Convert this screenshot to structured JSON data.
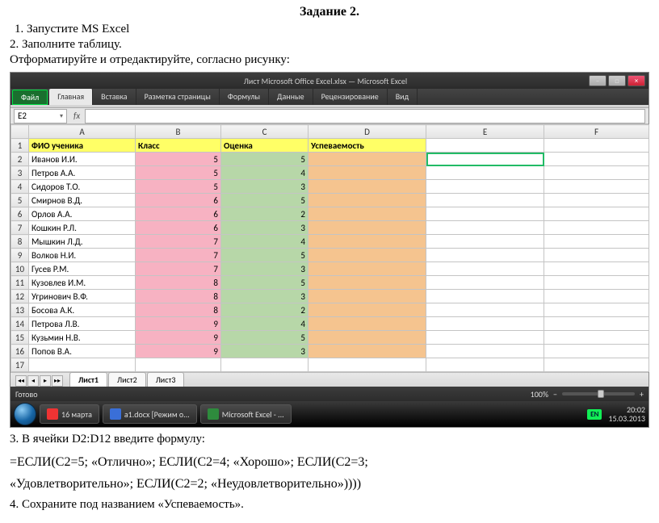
{
  "doc": {
    "title": "Задание 2.",
    "step1": "1. Запустите MS Excel",
    "step2": "2. Заполните таблицу.",
    "step2b": "Отформатируйте и отредактируйте, согласно рисунку:",
    "step3": "3. В ячейки D2:D12 введите формулу:",
    "formula_l1": "=ЕСЛИ(C2=5;  «Отлично»;  ЕСЛИ(C2=4;  «Хорошо»;  ЕСЛИ(C2=3;",
    "formula_l2": "«Удовлетворительно»; ЕСЛИ(C2=2; «Неудовлетворительно»))))",
    "step4": "4. Сохраните  под названием «Успеваемость»."
  },
  "excel": {
    "window_title": "Лист Microsoft Office Excel.xlsx  —  Microsoft Excel",
    "tabs": {
      "file": "Файл",
      "home": "Главная",
      "insert": "Вставка",
      "layout": "Разметка страницы",
      "formulas": "Формулы",
      "data": "Данные",
      "review": "Рецензирование",
      "view": "Вид"
    },
    "namebox": "E2",
    "fx": "fx",
    "columns": [
      "A",
      "B",
      "C",
      "D",
      "E",
      "F"
    ],
    "headers": {
      "A": "ФИО ученика",
      "B": "Класс",
      "C": "Оценка",
      "D": "Успеваемость"
    },
    "rows": [
      {
        "n": "2",
        "a": "Иванов И.И.",
        "b": "5",
        "c": "5"
      },
      {
        "n": "3",
        "a": "Петров А.А.",
        "b": "5",
        "c": "4"
      },
      {
        "n": "4",
        "a": "Сидоров Т.О.",
        "b": "5",
        "c": "3"
      },
      {
        "n": "5",
        "a": "Смирнов В.Д.",
        "b": "6",
        "c": "5"
      },
      {
        "n": "6",
        "a": "Орлов А.А.",
        "b": "6",
        "c": "2"
      },
      {
        "n": "7",
        "a": "Кошкин Р.Л.",
        "b": "6",
        "c": "3"
      },
      {
        "n": "8",
        "a": "Мышкин Л.Д.",
        "b": "7",
        "c": "4"
      },
      {
        "n": "9",
        "a": "Волков Н.И.",
        "b": "7",
        "c": "5"
      },
      {
        "n": "10",
        "a": "Гусев Р.М.",
        "b": "7",
        "c": "3"
      },
      {
        "n": "11",
        "a": "Кузовлев И.М.",
        "b": "8",
        "c": "5"
      },
      {
        "n": "12",
        "a": "Угринович В.Ф.",
        "b": "8",
        "c": "3"
      },
      {
        "n": "13",
        "a": "Босова А.К.",
        "b": "8",
        "c": "2"
      },
      {
        "n": "14",
        "a": "Петрова Л.В.",
        "b": "9",
        "c": "4"
      },
      {
        "n": "15",
        "a": "Кузьмин Н.В.",
        "b": "9",
        "c": "5"
      },
      {
        "n": "16",
        "a": "Попов В.А.",
        "b": "9",
        "c": "3"
      }
    ],
    "extra_row": "17",
    "sheets": {
      "s1": "Лист1",
      "s2": "Лист2",
      "s3": "Лист3"
    },
    "status": "Готово",
    "zoom": "100%"
  },
  "taskbar": {
    "date_label": "16 марта",
    "app_word": "a1.docx [Режим о...",
    "app_excel": "Microsoft Excel - ...",
    "lang": "EN",
    "time": "20:02",
    "date": "15.03.2013"
  }
}
